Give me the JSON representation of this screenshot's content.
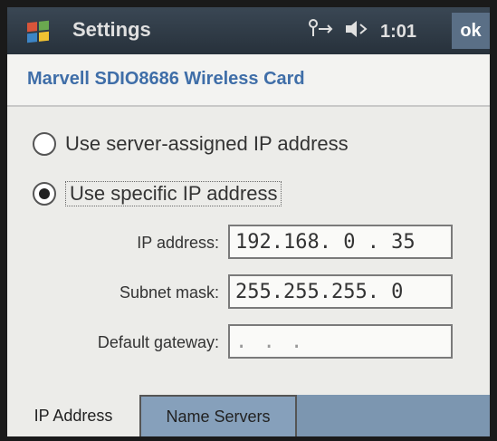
{
  "title_bar": {
    "app_title": "Settings",
    "status_icons": [
      "network-icon",
      "volume-icon"
    ],
    "time": "1:01",
    "ok_label": "ok"
  },
  "header": {
    "title": "Marvell SDIO8686 Wireless Card"
  },
  "ip_mode": {
    "options": [
      {
        "label": "Use server-assigned IP address",
        "selected": false
      },
      {
        "label": "Use specific IP address",
        "selected": true
      }
    ]
  },
  "fields": {
    "ip_address": {
      "label": "IP address:",
      "value": "192.168. 0 . 35"
    },
    "subnet_mask": {
      "label": "Subnet mask:",
      "value": "255.255.255. 0"
    },
    "default_gateway": {
      "label": "Default gateway:",
      "value": " .   .   . "
    }
  },
  "tabs": [
    {
      "label": "IP Address",
      "active": true
    },
    {
      "label": "Name Servers",
      "active": false
    }
  ],
  "colors": {
    "title_bar": "#2f3a45",
    "header_text": "#3f6ea8",
    "tab_bar": "#7c96b0"
  }
}
